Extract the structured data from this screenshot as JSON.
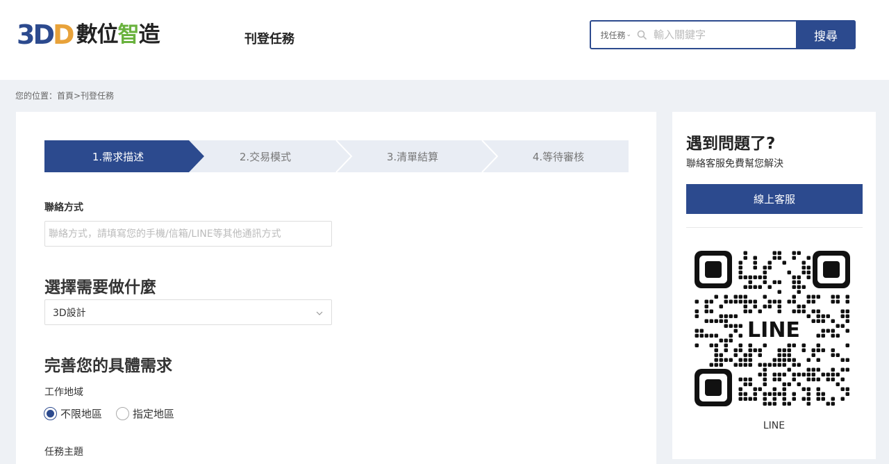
{
  "header": {
    "logo": {
      "part_3": "3",
      "part_d1": "D",
      "part_d2": "D",
      "text1": "數位",
      "text2": "智",
      "text3": "造"
    },
    "nav_post_task": "刊登任務",
    "search": {
      "type_label": "找任務",
      "placeholder": "輸入關鍵字",
      "button_label": "搜尋"
    }
  },
  "breadcrumb": "您的位置：首頁>刊登任務",
  "steps": [
    {
      "label": "1.需求描述",
      "active": true
    },
    {
      "label": "2.交易模式",
      "active": false
    },
    {
      "label": "3.清單結算",
      "active": false
    },
    {
      "label": "4.等待審核",
      "active": false
    }
  ],
  "form": {
    "contact_label": "聯絡方式",
    "contact_placeholder": "聯絡方式，請填寫您的手機/信箱/LINE等其他通訊方式",
    "choose_heading": "選擇需要做什麼",
    "choose_value": "3D設計",
    "detail_heading": "完善您的具體需求",
    "region_label": "工作地域",
    "region_options": [
      {
        "label": "不限地區",
        "checked": true
      },
      {
        "label": "指定地區",
        "checked": false
      }
    ],
    "topic_label": "任務主題"
  },
  "side": {
    "title": "遇到問題了?",
    "subtitle": "聯絡客服免費幫您解決",
    "button_label": "線上客服",
    "qr_label": "LINE",
    "qr_caption": "LINE"
  },
  "colors": {
    "primary": "#2c4a8e",
    "step_inactive": "#e9edf4",
    "logo_orange": "#e8a23a",
    "logo_green": "#6ab23e"
  }
}
